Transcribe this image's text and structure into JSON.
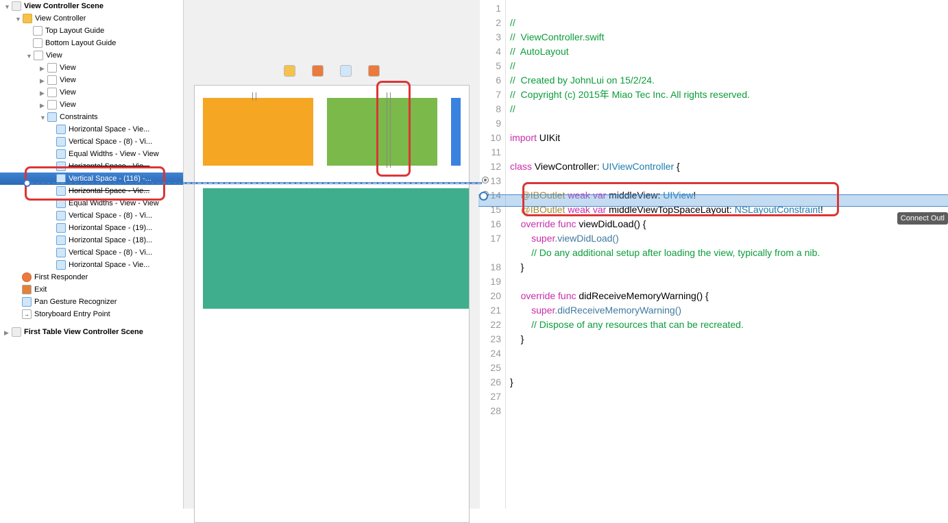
{
  "tree": {
    "scene1": "View Controller Scene",
    "vc": "View Controller",
    "tlg": "Top Layout Guide",
    "blg": "Bottom Layout Guide",
    "view": "View",
    "subview": "View",
    "constraints": "Constraints",
    "c": [
      "Horizontal Space - Vie...",
      "Vertical Space - (8) - Vi...",
      "Equal Widths - View - View",
      "Horizontal Space - Vie...",
      "Vertical Space - (116) -...",
      "Horizontal Space - Vie...",
      "Equal Widths - View - View",
      "Vertical Space - (8) - Vi...",
      "Horizontal Space - (19)...",
      "Horizontal Space - (18)...",
      "Vertical Space - (8) - Vi...",
      "Horizontal Space - Vie..."
    ],
    "fr": "First Responder",
    "exit": "Exit",
    "pgr": "Pan Gesture Recognizer",
    "sep": "Storyboard Entry Point",
    "scene2": "First Table View Controller Scene"
  },
  "code": {
    "lines": {
      "l1": "//",
      "l2": "//  ViewController.swift",
      "l3": "//  AutoLayout",
      "l4": "//",
      "l5": "//  Created by JohnLui on 15/2/24.",
      "l6": "//  Copyright (c) 2015年 Miao Tec Inc. All rights reserved.",
      "l7": "//",
      "l9_import": "import",
      "l9_uikit": " UIKit",
      "l11_class": "class",
      "l11_name": " ViewController: ",
      "l11_super": "UIViewController",
      "l11_brace": " {",
      "l13_a": "@IBOutlet",
      "l13_b": " weak var",
      "l13_c": " middleView: ",
      "l13_d": "UIView",
      "l13_e": "!",
      "l14_a": "@IBOutlet",
      "l14_b": " weak var",
      "l14_c": " middleViewTopSpaceLayout: ",
      "l14_d": "NSLayoutConstraint",
      "l14_e": "!",
      "l15_a": "override",
      "l15_b": " func",
      "l15_c": " viewDidLoad() {",
      "l16_a": "super",
      "l16_b": ".viewDidLoad()",
      "l17": "// Do any additional setup after loading the view, typically from a nib.",
      "l18": "}",
      "l20_a": "override",
      "l20_b": " func",
      "l20_c": " didReceiveMemoryWarning() {",
      "l21_a": "super",
      "l21_b": ".didReceiveMemoryWarning()",
      "l22": "// Dispose of any resources that can be recreated.",
      "l23": "}",
      "l26": "}"
    }
  },
  "tooltip": "Connect Outl"
}
